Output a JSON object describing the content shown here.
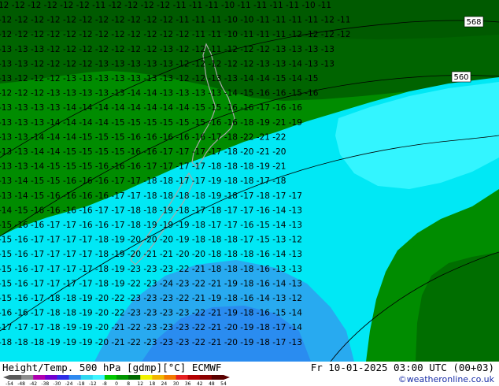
{
  "product": {
    "title": "Height/Temp. 500 hPa [gdmp][°C] ECMWF",
    "valid_time": "Fr 10-01-2025 03:00 UTC (00+03)",
    "credit": "©weatheronline.co.uk"
  },
  "colorbar": {
    "ticks": [
      "-54",
      "-48",
      "-42",
      "-38",
      "-30",
      "-24",
      "-18",
      "-12",
      "-8",
      "0",
      "8",
      "12",
      "18",
      "24",
      "30",
      "36",
      "42",
      "48",
      "54"
    ],
    "colors": [
      "#5a5a5a",
      "#8c8c8c",
      "#b000b0",
      "#7000d0",
      "#2e2ee6",
      "#2f8af0",
      "#2fd8f0",
      "#3ff5ff",
      "#00c800",
      "#009600",
      "#006a00",
      "#f2f200",
      "#f2b400",
      "#f27800",
      "#e62020",
      "#b40000",
      "#8c0000",
      "#5a0000"
    ]
  },
  "map": {
    "height_labels": [
      "568",
      "560"
    ],
    "colors": {
      "green_dark": "#006400",
      "green": "#008c00",
      "cyan": "#00e8f5",
      "cyan_light": "#33f5ff",
      "blue": "#28aaf0",
      "coast": "#a8a8a8"
    },
    "temperature_rows": [
      "12 -12 -12 -12 -12 -12 -11 -12 -12 -12 -12 -11 -11 -11 -10 -11 -11 -11 -11 -10 -11",
      "-12 -12 -12 -12 -12 -12 -12 -12 -12 -12 -12 -11 -11 -11 -10 -10 -11 -11 -11 -11 -12 -11",
      "-12 -12 -12 -12 -12 -12 -12 -12 -12 -12 -12 -12 -11 -11 -10 -11 -11 -11 -12 -12 -12 -12",
      "-13 -13 -13 -12 -12 -12 -12 -12 -12 -12 -13 -12 -12 -11 -12 -12 -12 -13 -13 -13 -13",
      "-13 -13 -12 -12 -12 -12 -13 -13 -13 -13 -13 -12 -12 -12 -12 -12 -13 -13 -14 -13 -13",
      "-13 -12 -12 -12 -13 -13 -13 -13 -13 -13 -13 -12 -12 -13 -13 -14 -14 -15 -14 -15",
      "-12 -12 -12 -13 -13 -13 -13 -13 -14 -14 -13 -13 -13 -13 -14 -15 -16 -16 -15 -16",
      "-13 -13 -13 -13 -14 -14 -14 -14 -14 -14 -14 -14 -15 -15 -16 -16 -17 -16 -16",
      "-13 -13 -13 -14 -14 -14 -14 -15 -15 -15 -15 -15 -15 -16 -16 -18 -19 -21 -19",
      "-13 -13 -14 -14 -14 -15 -15 -15 -16 -16 -16 -16 -16 -17 -18 -22 -21 -22",
      "-13 -13 -14 -14 -15 -15 -15 -15 -16 -16 -17 -17 -17 -17 -18 -20 -21 -20",
      "-13 -13 -14 -15 -15 -15 -16 -16 -16 -17 -17 -17 -17 -18 -18 -18 -19 -21",
      "-13 -14 -15 -15 -16 -16 -16 -17 -17 -18 -18 -17 -17 -19 -18 -18 -17 -18",
      "-13 -14 -15 -16 -16 -16 -16 -17 -17 -18 -18 -18 -18 -19 -18 -17 -18 -17 -17",
      "-14 -15 -16 -16 -16 -16 -17 -17 -18 -18 -19 -18 -17 -18 -17 -17 -16 -14 -13",
      "-15 -16 -16 -17 -17 -16 -16 -17 -18 -19 -19 -19 -18 -17 -17 -16 -15 -14 -13",
      "-15 -16 -17 -17 -17 -17 -18 -19 -20 -20 -20 -19 -18 -18 -18 -17 -15 -13 -12",
      "-15 -16 -17 -17 -17 -17 -18 -19 -20 -21 -21 -20 -20 -18 -18 -18 -16 -14 -13",
      "-15 -16 -17 -17 -17 -17 -18 -19 -23 -23 -23 -22 -21 -18 -18 -18 -16 -13 -13",
      "-15 -16 -17 -17 -17 -17 -18 -19 -22 -23 -24 -23 -22 -21 -19 -18 -16 -14 -13",
      "-15 -16 -17 -18 -18 -19 -20 -22 -23 -23 -23 -22 -21 -19 -18 -16 -14 -13 -12",
      "-16 -16 -17 -18 -18 -19 -20 -22 -23 -23 -23 -23 -22 -21 -19 -18 -16 -15 -14",
      "-17 -17 -17 -18 -19 -19 -20 -21 -22 -23 -23 -23 -22 -21 -20 -19 -18 -17 -14",
      "-18 -18 -18 -19 -19 -19 -20 -21 -22 -23 -23 -23 -22 -21 -20 -19 -18 -17 -13"
    ]
  }
}
